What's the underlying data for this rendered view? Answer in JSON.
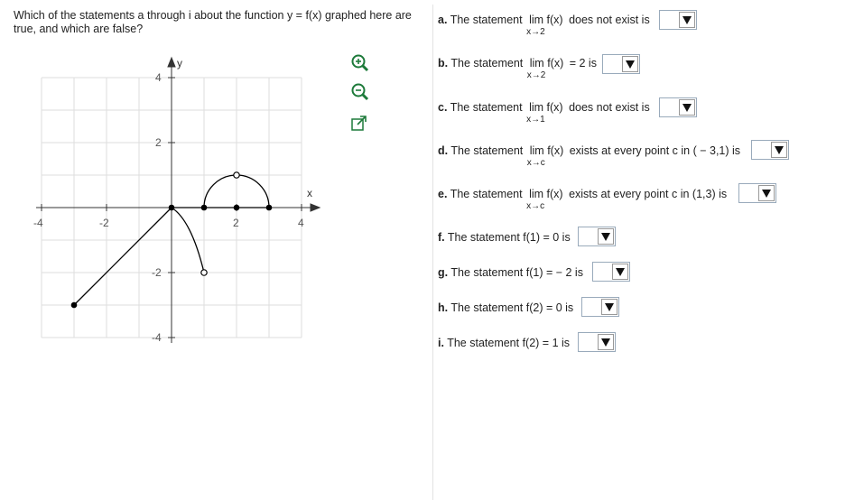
{
  "question": "Which of the statements a through i about the function y = f(x) graphed here are true, and which are false?",
  "graph": {
    "x_label": "x",
    "y_label": "y",
    "x_ticks": [
      "-4",
      "-2",
      "2",
      "4"
    ],
    "y_ticks": [
      "4",
      "2",
      "-2",
      "-4"
    ]
  },
  "tools": [
    "zoom-in-icon",
    "zoom-out-icon",
    "popout-icon"
  ],
  "statements": [
    {
      "letter": "a.",
      "pre": "The statement",
      "lim": "lim f(x)",
      "sub": "x→2",
      "post": "does not exist is",
      "value": ""
    },
    {
      "letter": "b.",
      "pre": "The statement",
      "lim": "lim f(x)",
      "sub": "x→2",
      "post": "= 2 is",
      "value": ""
    },
    {
      "letter": "c.",
      "pre": "The statement",
      "lim": "lim f(x)",
      "sub": "x→1",
      "post": "does not exist is",
      "value": ""
    },
    {
      "letter": "d.",
      "pre": "The statement",
      "lim": "lim f(x)",
      "sub": "x→c",
      "post": "exists at every point c in ( − 3,1) is",
      "value": ""
    },
    {
      "letter": "e.",
      "pre": "The statement",
      "lim": "lim f(x)",
      "sub": "x→c",
      "post": "exists at every point c in (1,3) is",
      "value": ""
    },
    {
      "letter": "f.",
      "pre": "The statement f(1) = 0 is",
      "value": ""
    },
    {
      "letter": "g.",
      "pre": "The statement f(1) = − 2 is",
      "value": ""
    },
    {
      "letter": "h.",
      "pre": "The statement f(2) = 0 is",
      "value": ""
    },
    {
      "letter": "i.",
      "pre": "The statement f(2) = 1 is",
      "value": ""
    }
  ]
}
